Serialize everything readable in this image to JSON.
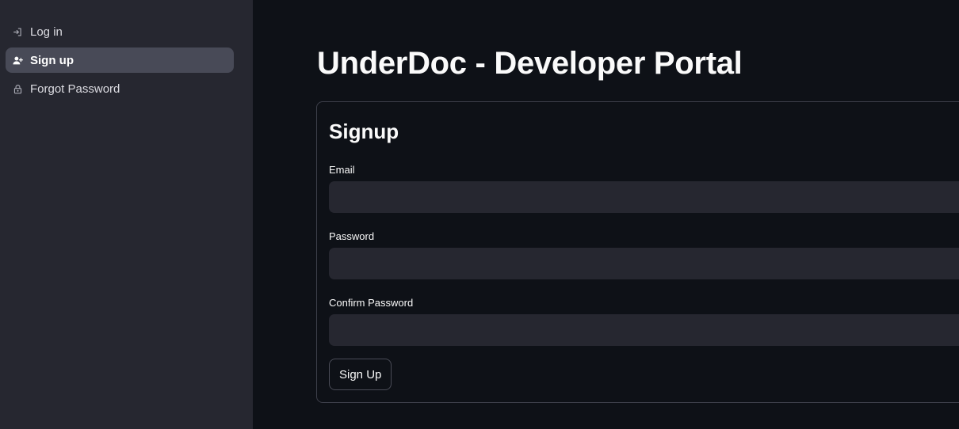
{
  "sidebar": {
    "items": [
      {
        "label": "Log in",
        "icon": "login-icon",
        "active": false
      },
      {
        "label": "Sign up",
        "icon": "person-add-icon",
        "active": true
      },
      {
        "label": "Forgot Password",
        "icon": "lock-icon",
        "active": false
      }
    ]
  },
  "main": {
    "title": "UnderDoc - Developer Portal",
    "form": {
      "title": "Signup",
      "fields": {
        "email": {
          "label": "Email",
          "value": "",
          "placeholder": ""
        },
        "password": {
          "label": "Password",
          "value": "",
          "placeholder": ""
        },
        "confirm_password": {
          "label": "Confirm Password",
          "value": "",
          "placeholder": ""
        }
      },
      "submit_label": "Sign Up"
    }
  },
  "colors": {
    "background": "#0e1117",
    "sidebar": "#262730",
    "active_item": "#484a57",
    "input": "#262730",
    "text": "#fafafa"
  }
}
